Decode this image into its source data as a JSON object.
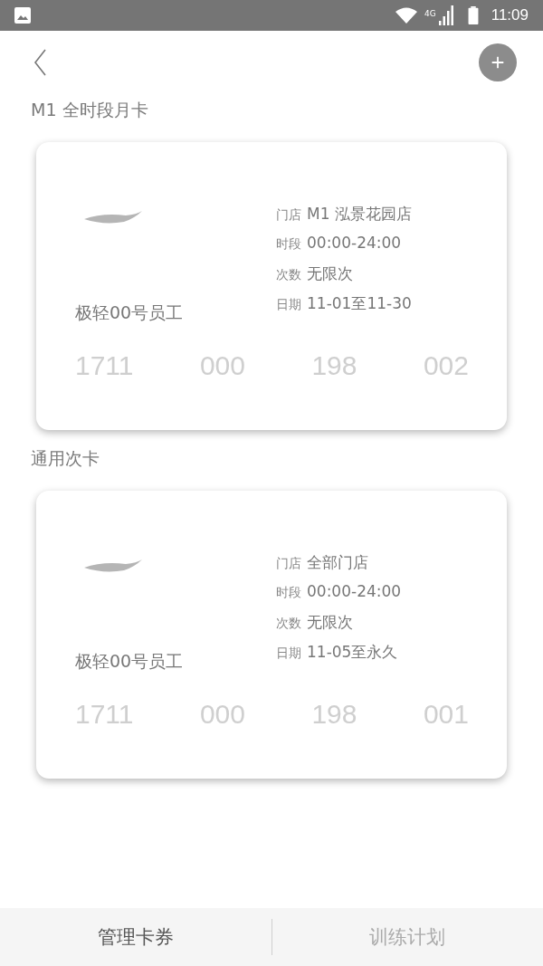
{
  "status_bar": {
    "time": "11:09",
    "network": "4G"
  },
  "sections": [
    {
      "title": "M1 全时段月卡",
      "card": {
        "holder": "极轻00号员工",
        "details": [
          {
            "label": "门店",
            "value": "M1 泓景花园店"
          },
          {
            "label": "时段",
            "value": "00:00-24:00"
          },
          {
            "label": "次数",
            "value": "无限次"
          },
          {
            "label": "日期",
            "value": "11-01至11-30"
          }
        ],
        "number": [
          "1711",
          "000",
          "198",
          "002"
        ]
      }
    },
    {
      "title": "通用次卡",
      "card": {
        "holder": "极轻00号员工",
        "details": [
          {
            "label": "门店",
            "value": "全部门店"
          },
          {
            "label": "时段",
            "value": "00:00-24:00"
          },
          {
            "label": "次数",
            "value": "无限次"
          },
          {
            "label": "日期",
            "value": "11-05至永久"
          }
        ],
        "number": [
          "1711",
          "000",
          "198",
          "001"
        ]
      }
    }
  ],
  "tabs": [
    {
      "label": "管理卡券",
      "selected": true
    },
    {
      "label": "训练计划",
      "selected": false
    }
  ]
}
